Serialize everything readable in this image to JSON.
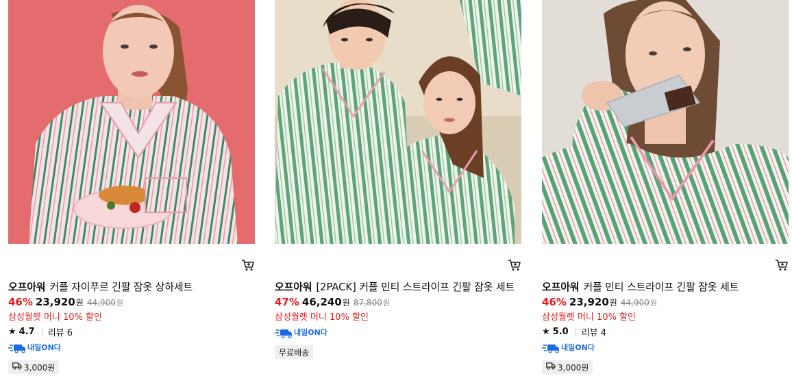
{
  "products": [
    {
      "brand": "오프아워",
      "name": "커플 자이푸르 긴팔 잠옷 상하세트",
      "discount": "46%",
      "price": "23,920",
      "price_unit": "원",
      "original_price": "44,900",
      "original_unit": "원",
      "promo": "삼성월렛 머니 10% 할인",
      "rating": "4.7",
      "reviews": "리뷰 6",
      "delivery_badge": "내일ON다",
      "shipping": "3,000원"
    },
    {
      "brand": "오프아워",
      "name": "[2PACK] 커플 민티 스트라이프 긴팔 잠옷 세트",
      "discount": "47%",
      "price": "46,240",
      "price_unit": "원",
      "original_price": "87,800",
      "original_unit": "원",
      "promo": "삼성월렛 머니 10% 할인",
      "delivery_badge": "내일ON다",
      "shipping": "무료배송"
    },
    {
      "brand": "오프아워",
      "name": "커플 민티 스트라이프 긴팔 잠옷 세트",
      "discount": "46%",
      "price": "23,920",
      "price_unit": "원",
      "original_price": "44,900",
      "original_unit": "원",
      "promo": "삼성월렛 머니 10% 할인",
      "rating": "5.0",
      "reviews": "리뷰 4",
      "delivery_badge": "내일ON다",
      "shipping": "3,000원"
    }
  ],
  "icons": {
    "cart": "cart-icon",
    "star": "star-icon",
    "truck": "truck-icon",
    "delivery": "fast-delivery-icon"
  },
  "colors": {
    "discount": "#e21b1b",
    "promo": "#e21b1b",
    "delivery_blue": "#1a6be0",
    "badge_bg": "#efefef"
  }
}
